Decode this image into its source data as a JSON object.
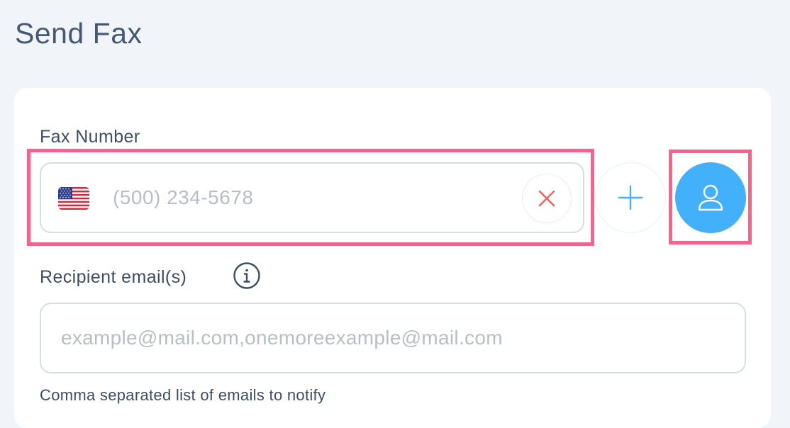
{
  "page": {
    "title": "Send Fax"
  },
  "fax_number": {
    "label": "Fax Number",
    "placeholder": "(500) 234-5678",
    "country_flag_icon": "us-flag-icon",
    "clear_icon": "close-icon",
    "add_icon": "plus-icon",
    "contacts_icon": "user-icon"
  },
  "recipient_emails": {
    "label": "Recipient email(s)",
    "info_icon": "info-icon",
    "placeholder": "example@mail.com,onemoreexample@mail.com",
    "helper_text": "Comma separated list of emails to notify"
  },
  "colors": {
    "accent": "#42b0fb",
    "highlight": "#fe5f8c",
    "clear_icon": "#f0605d",
    "placeholder": "#b8bec8",
    "text": "#3e4d63"
  }
}
